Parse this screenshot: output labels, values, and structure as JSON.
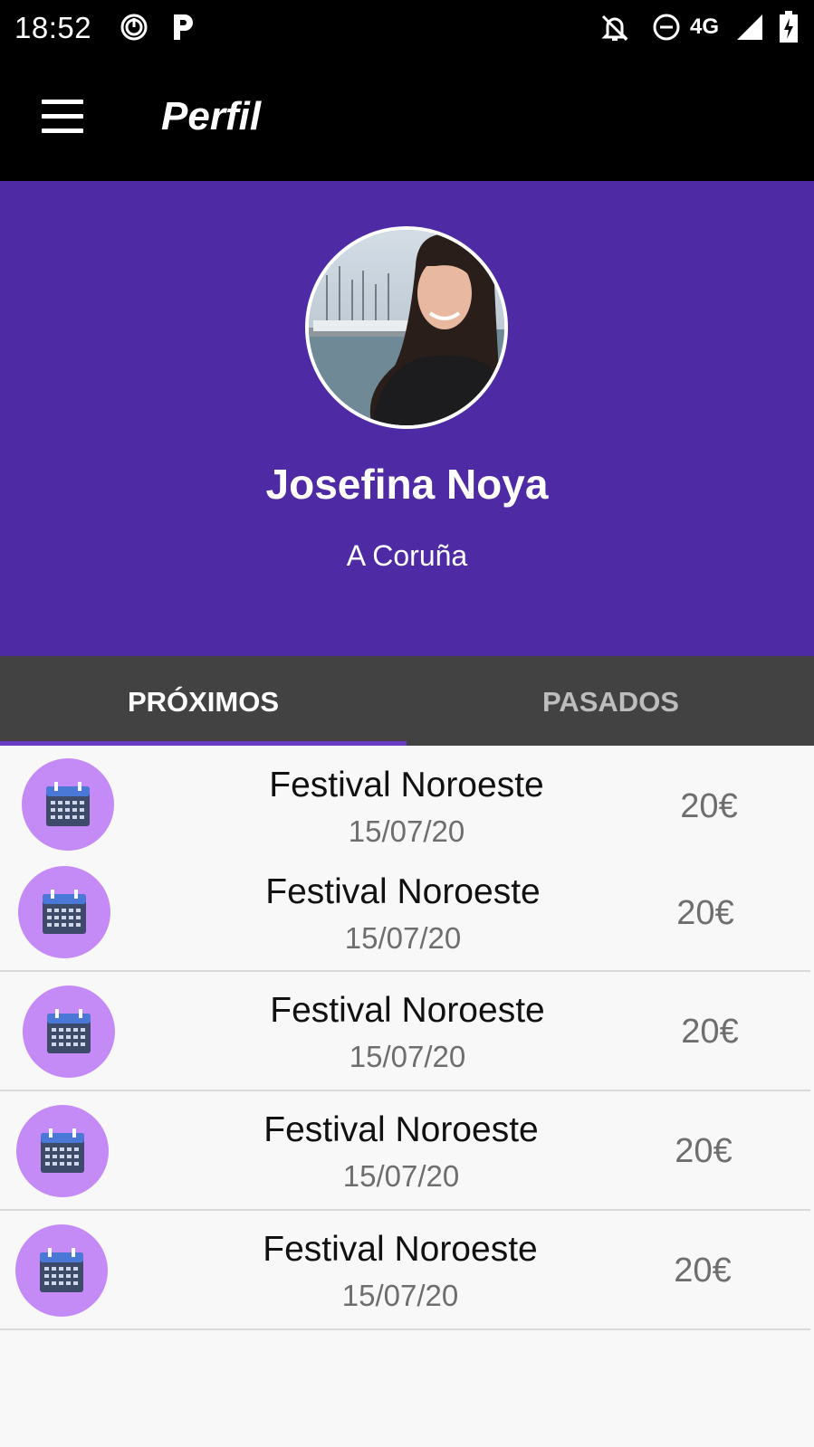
{
  "status_bar": {
    "time": "18:52",
    "network": "4G",
    "icons": [
      "power-icon",
      "parking-icon",
      "alarm-off-icon",
      "do-not-disturb-icon",
      "signal-icon",
      "battery-charging-icon"
    ]
  },
  "app_bar": {
    "title": "Perfil",
    "menu_icon": "menu-icon"
  },
  "profile": {
    "name": "Josefina Noya",
    "city": "A Coruña",
    "header_color": "#4e2aa5"
  },
  "tabs": [
    {
      "label": "PRÓXIMOS",
      "active": true
    },
    {
      "label": "PASADOS",
      "active": false
    }
  ],
  "events": [
    {
      "title": "Festival Noroeste",
      "date": "15/07/20",
      "price": "20€",
      "icon": "calendar-icon"
    },
    {
      "title": "Festival Noroeste",
      "date": "15/07/20",
      "price": "20€",
      "icon": "calendar-icon"
    },
    {
      "title": "Festival Noroeste",
      "date": "15/07/20",
      "price": "20€",
      "icon": "calendar-icon"
    },
    {
      "title": "Festival Noroeste",
      "date": "15/07/20",
      "price": "20€",
      "icon": "calendar-icon"
    },
    {
      "title": "Festival Noroeste",
      "date": "15/07/20",
      "price": "20€",
      "icon": "calendar-icon"
    }
  ]
}
